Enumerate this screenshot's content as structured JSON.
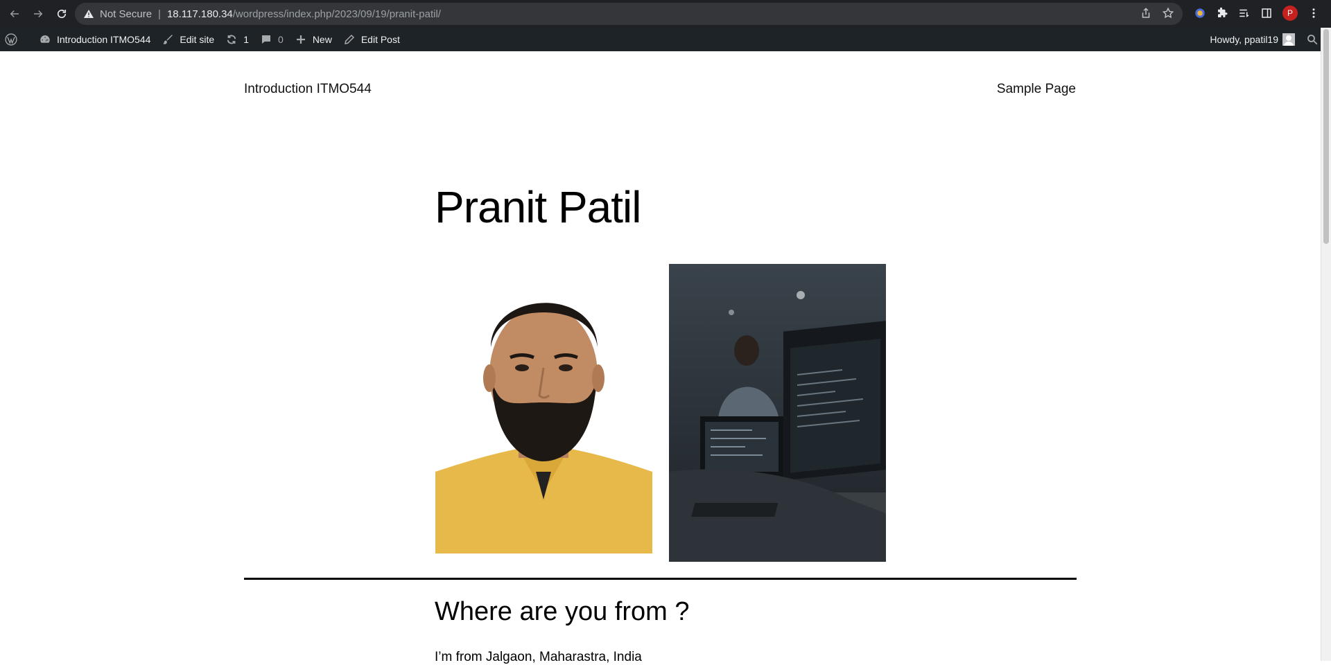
{
  "browser": {
    "security_label": "Not Secure",
    "url_host": "18.117.180.34",
    "url_path": "/wordpress/index.php/2023/09/19/pranit-patil/",
    "profile_initial": "P"
  },
  "adminbar": {
    "site_name": "Introduction ITMO544",
    "edit_site": "Edit site",
    "updates_count": "1",
    "comments_count": "0",
    "new_label": "New",
    "edit_post": "Edit Post",
    "howdy": "Howdy, ppatil19"
  },
  "site": {
    "title": "Introduction ITMO544",
    "nav_sample_page": "Sample Page"
  },
  "post": {
    "title": "Pranit Patil",
    "section_heading": "Where are you from ?",
    "section_text": "I’m from Jalgaon, Maharastra, India"
  }
}
